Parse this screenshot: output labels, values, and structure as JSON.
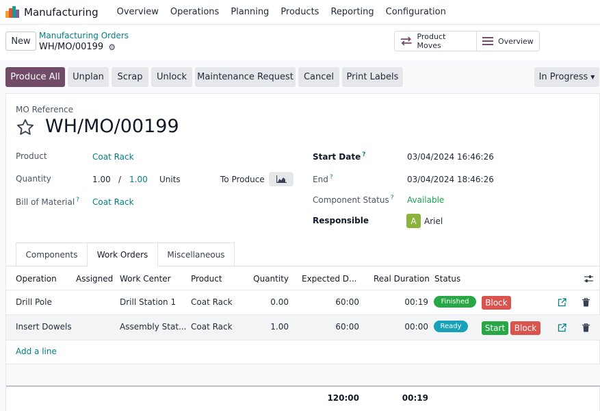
{
  "app": {
    "name": "Manufacturing"
  },
  "nav": [
    "Overview",
    "Operations",
    "Planning",
    "Products",
    "Reporting",
    "Configuration"
  ],
  "control": {
    "new_label": "New",
    "breadcrumb": "Manufacturing Orders",
    "record": "WH/MO/00199",
    "smart_buttons": {
      "moves": "Product Moves",
      "overview": "Overview"
    }
  },
  "actions": {
    "produce_all": "Produce All",
    "unplan": "Unplan",
    "scrap": "Scrap",
    "unlock": "Unlock",
    "maintenance": "Maintenance Request",
    "cancel": "Cancel",
    "print_labels": "Print Labels",
    "status": "In Progress",
    "primary_color": "#714b67"
  },
  "form": {
    "ref_label": "MO Reference",
    "ref": "WH/MO/00199",
    "product_label": "Product",
    "product": "Coat Rack",
    "quantity_label": "Quantity",
    "qty_produced": "1.00",
    "qty_sep": "/",
    "qty_total": "1.00",
    "uom": "Units",
    "to_produce_label": "To Produce",
    "bom_label": "Bill of Material",
    "bom": "Coat Rack",
    "start_label": "Start Date",
    "start": "03/04/2024 16:46:26",
    "end_label": "End",
    "end": "03/04/2024 18:46:26",
    "component_status_label": "Component Status",
    "component_status": "Available",
    "responsible_label": "Responsible",
    "responsible_initial": "A",
    "responsible": "Ariel",
    "help_mark": "?"
  },
  "tabs": [
    "Components",
    "Work Orders",
    "Miscellaneous"
  ],
  "active_tab": "Work Orders",
  "table": {
    "columns": [
      "Operation",
      "Assigned",
      "Work Center",
      "Product",
      "Quantity",
      "Expected D...",
      "Real Duration",
      "Status"
    ],
    "rows": [
      {
        "operation": "Drill Pole",
        "assigned": "",
        "work_center": "Drill Station 1",
        "product": "Coat Rack",
        "quantity": "0.00",
        "expected": "60:00",
        "real": "00:19",
        "status": "Finished",
        "buttons": [
          "Block"
        ]
      },
      {
        "operation": "Insert Dowels",
        "assigned": "",
        "work_center": "Assembly Stat...",
        "product": "Coat Rack",
        "quantity": "1.00",
        "expected": "60:00",
        "real": "00:00",
        "status": "Ready",
        "buttons": [
          "Start",
          "Block"
        ]
      }
    ],
    "add_line": "Add a line",
    "totals": {
      "expected": "120:00",
      "real": "00:19"
    }
  },
  "icons": {
    "brand": "manufacturing-logo-icon",
    "gear": "gear-icon",
    "moves": "arrows-exchange-icon",
    "overview": "list-icon",
    "star": "star-icon",
    "chart": "area-chart-icon",
    "settings": "sliders-icon",
    "open": "external-link-icon",
    "delete": "trash-icon"
  }
}
